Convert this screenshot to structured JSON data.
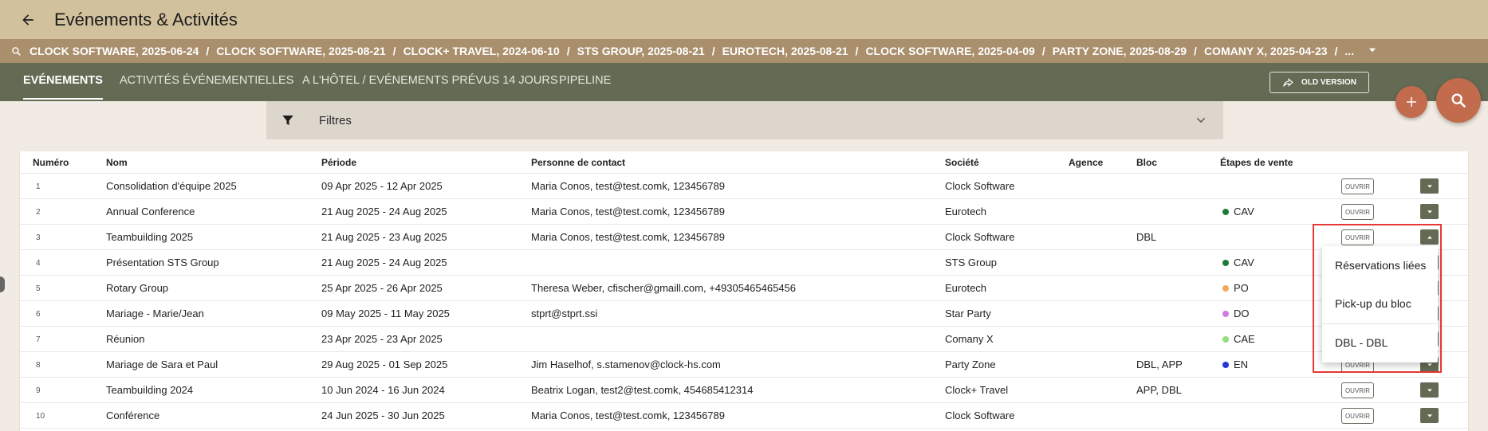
{
  "header": {
    "title": "Evénements & Activités"
  },
  "breadcrumbs": [
    "CLOCK SOFTWARE, 2025-06-24",
    "CLOCK SOFTWARE, 2025-08-21",
    "CLOCK+ TRAVEL, 2024-06-10",
    "STS GROUP, 2025-08-21",
    "EUROTECH, 2025-08-21",
    "CLOCK SOFTWARE, 2025-04-09",
    "PARTY ZONE, 2025-08-29",
    "COMANY X, 2025-04-23",
    "..."
  ],
  "breadcrumb_separator": "/",
  "tabs": [
    {
      "label": "EVÉNEMENTS"
    },
    {
      "label": "ACTIVITÉS ÉVÉNEMENTIELLES"
    },
    {
      "label": "A L'HÔTEL / EVÉNEMENTS PRÉVUS 14 JOURS"
    },
    {
      "label": "PIPELINE"
    }
  ],
  "old_version_label": "OLD VERSION",
  "filters": {
    "label": "Filtres"
  },
  "table": {
    "headers": {
      "numero": "Numéro",
      "nom": "Nom",
      "periode": "Période",
      "contact": "Personne de contact",
      "societe": "Société",
      "agence": "Agence",
      "bloc": "Bloc",
      "etapes": "Étapes de vente"
    },
    "open_label": "OUVRIR",
    "rows": [
      {
        "num": "1",
        "nom": "Consolidation d'équipe 2025",
        "periode": "09 Apr 2025 - 12 Apr 2025",
        "contact": "Maria Conos, test@test.comk, 123456789",
        "societe": "Clock Software",
        "agence": "",
        "bloc": "",
        "stage": "",
        "stage_color": ""
      },
      {
        "num": "2",
        "nom": "Annual Conference",
        "periode": "21 Aug 2025 - 24 Aug 2025",
        "contact": "Maria Conos, test@test.comk, 123456789",
        "societe": "Eurotech",
        "agence": "",
        "bloc": "",
        "stage": "CAV",
        "stage_color": "#1e7a3a"
      },
      {
        "num": "3",
        "nom": "Teambuilding 2025",
        "periode": "21 Aug 2025 - 23 Aug 2025",
        "contact": "Maria Conos, test@test.comk, 123456789",
        "societe": "Clock Software",
        "agence": "",
        "bloc": "DBL",
        "stage": "",
        "stage_color": ""
      },
      {
        "num": "4",
        "nom": "Présentation STS Group",
        "periode": "21 Aug 2025 - 24 Aug 2025",
        "contact": "",
        "societe": "STS Group",
        "agence": "",
        "bloc": "",
        "stage": "CAV",
        "stage_color": "#1e7a3a"
      },
      {
        "num": "5",
        "nom": "Rotary Group",
        "periode": "25 Apr 2025 - 26 Apr 2025",
        "contact": "Theresa Weber, cfischer@gmaill.com, +49305465465456",
        "societe": "Eurotech",
        "agence": "",
        "bloc": "",
        "stage": "PO",
        "stage_color": "#f0a85a"
      },
      {
        "num": "6",
        "nom": "Mariage - Marie/Jean",
        "periode": "09 May 2025 - 11 May 2025",
        "contact": "stprt@stprt.ssi",
        "societe": "Star Party",
        "agence": "",
        "bloc": "",
        "stage": "DO",
        "stage_color": "#d07be0"
      },
      {
        "num": "7",
        "nom": "Réunion",
        "periode": "23 Apr 2025 - 23 Apr 2025",
        "contact": "",
        "societe": "Comany X",
        "agence": "",
        "bloc": "",
        "stage": "CAE",
        "stage_color": "#8fe07a"
      },
      {
        "num": "8",
        "nom": "Mariage de Sara et Paul",
        "periode": "29 Aug 2025 - 01 Sep 2025",
        "contact": "Jim Haselhof, s.stamenov@clock-hs.com",
        "societe": "Party Zone",
        "agence": "",
        "bloc": "DBL, APP",
        "stage": "EN",
        "stage_color": "#2438d8"
      },
      {
        "num": "9",
        "nom": "Teambuilding 2024",
        "periode": "10 Jun 2024 - 16 Jun 2024",
        "contact": "Beatrix Logan, test2@test.comk, 454685412314",
        "societe": "Clock+ Travel",
        "agence": "",
        "bloc": "APP, DBL",
        "stage": "",
        "stage_color": ""
      },
      {
        "num": "10",
        "nom": "Conférence",
        "periode": "24 Jun 2025 - 30 Jun 2025",
        "contact": "Maria Conos, test@test.comk, 123456789",
        "societe": "Clock Software",
        "agence": "",
        "bloc": "",
        "stage": "",
        "stage_color": ""
      }
    ]
  },
  "dropdown": {
    "items": [
      "Réservations liées",
      "Pick-up du bloc",
      "DBL - DBL"
    ]
  },
  "colors": {
    "header_bg": "#d2c19d",
    "breadcrumb_bg": "#a98f6c",
    "tabs_bg": "#636b54",
    "fab": "#c26b4d",
    "highlight": "#e53935"
  }
}
